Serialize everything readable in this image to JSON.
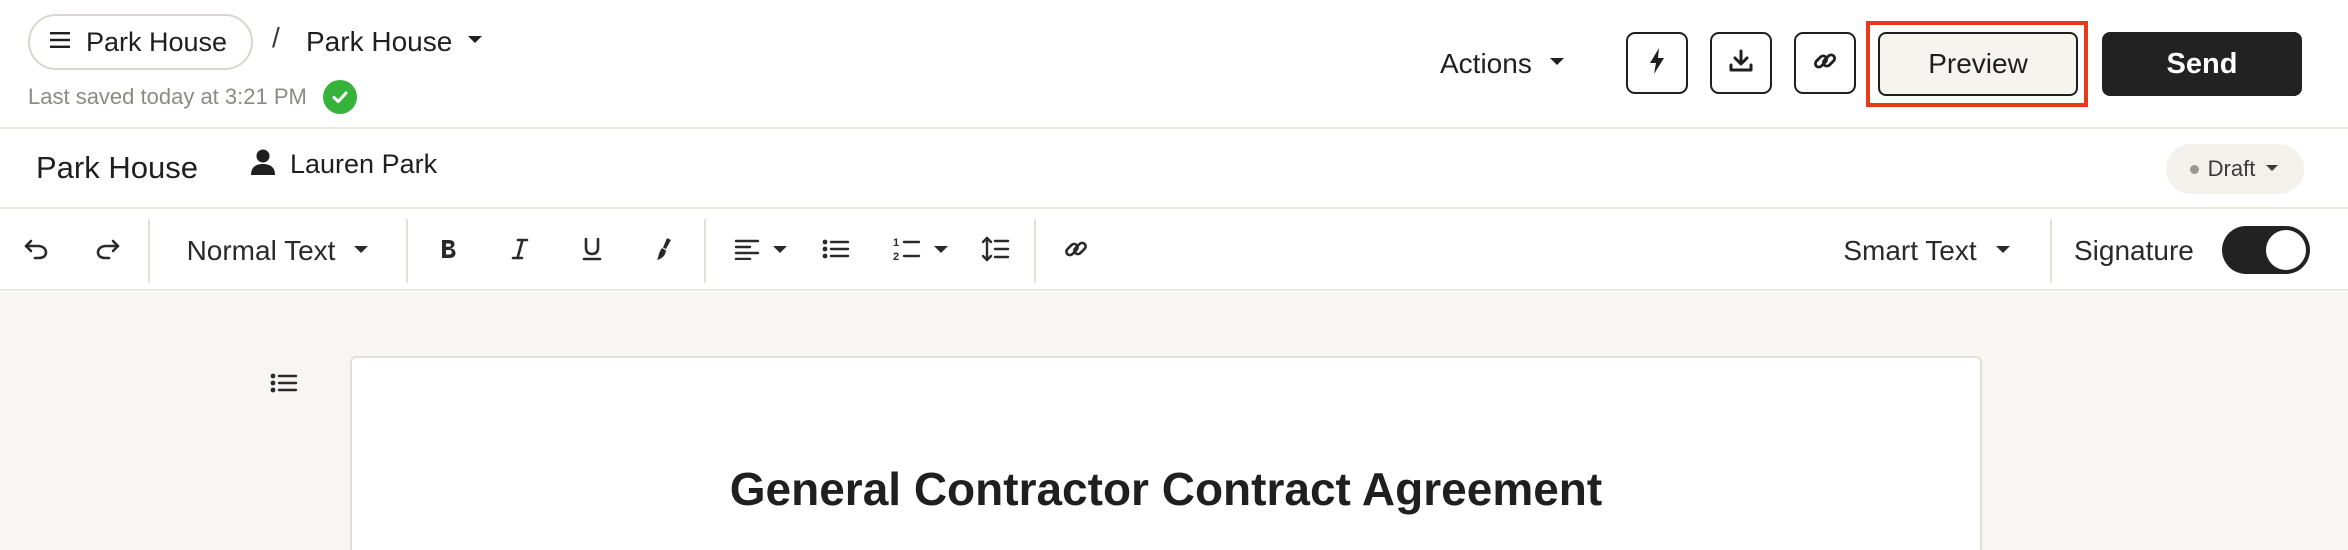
{
  "header": {
    "menu_pill_label": "Park House",
    "breadcrumb_separator": "/",
    "document_name": "Park House",
    "saved_text": "Last saved today at 3:21 PM",
    "actions_label": "Actions",
    "preview_label": "Preview",
    "send_label": "Send",
    "icon_buttons": [
      "lightning-icon",
      "download-icon",
      "link-icon"
    ]
  },
  "document_header": {
    "title": "Park House",
    "owner_name": "Lauren Park",
    "status_label": "Draft"
  },
  "toolbar": {
    "text_style": "Normal Text",
    "smart_text_label": "Smart Text",
    "signature_label": "Signature",
    "signature_enabled": true
  },
  "document": {
    "heading": "General Contractor Contract Agreement"
  },
  "colors": {
    "accent_dark": "#222222",
    "highlight_outline": "#e8391b",
    "saved_check": "#36b33b",
    "canvas_bg": "#f7f6f3"
  }
}
